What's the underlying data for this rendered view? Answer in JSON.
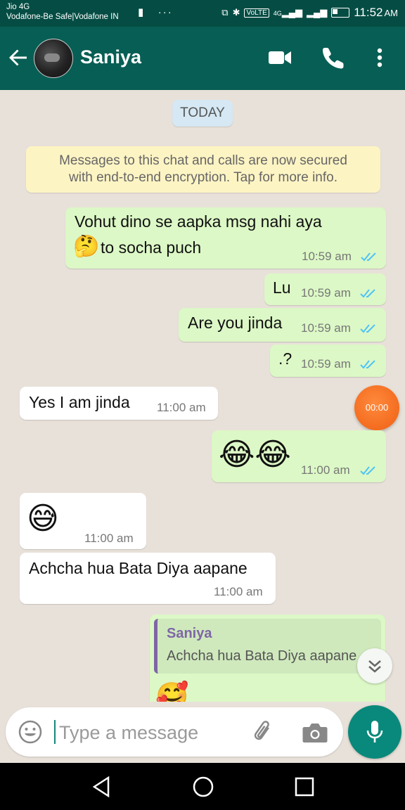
{
  "status_bar": {
    "carrier1": "Jio 4G",
    "carrier2": "Vodafone-Be Safe|Vodafone IN",
    "volte": "VoLTE",
    "network_4g": "4G",
    "time": "11:52",
    "ampm": "AM"
  },
  "header": {
    "contact_name": "Saniya",
    "icons": [
      "back-arrow-icon",
      "video-call-icon",
      "voice-call-icon",
      "more-options-icon"
    ]
  },
  "chat": {
    "date_label": "TODAY",
    "encryption_notice_line1": "Messages to this chat and calls are now secured",
    "encryption_notice_line2": "with end-to-end encryption. Tap for more info.",
    "messages": [
      {
        "direction": "out",
        "line1": "Vohut dino se aapka msg nahi aya",
        "emoji": "🤔",
        "line2": "to socha puch",
        "time": "10:59 am",
        "status": "read"
      },
      {
        "direction": "out",
        "text": "Lu",
        "time": "10:59 am",
        "status": "read"
      },
      {
        "direction": "out",
        "text": "Are you jinda",
        "time": "10:59 am",
        "status": "read"
      },
      {
        "direction": "out",
        "text": ".?",
        "time": "10:59 am",
        "status": "read"
      },
      {
        "direction": "in",
        "text": "Yes I am jinda",
        "time": "11:00 am"
      },
      {
        "direction": "out",
        "emoji": "😂😂",
        "time": "11:00 am",
        "status": "read"
      },
      {
        "direction": "in",
        "emoji": "😅",
        "time": "11:00 am"
      },
      {
        "direction": "in",
        "text": "Achcha hua Bata Diya aapane",
        "time": "11:00 am"
      },
      {
        "direction": "out",
        "reply_to_name": "Saniya",
        "reply_to_text": "Achcha hua Bata Diya aapane",
        "emoji": "🥰"
      }
    ],
    "recording_timer": "00:00"
  },
  "input_bar": {
    "placeholder": "Type a message",
    "value": ""
  },
  "colors": {
    "header": "#075e54",
    "status_bar": "#054d44",
    "outgoing_bubble": "#dcf8c6",
    "incoming_bubble": "#ffffff",
    "read_ticks": "#4fc3f7",
    "mic_button": "#09897b",
    "recording_bubble": "#f26b1d"
  }
}
